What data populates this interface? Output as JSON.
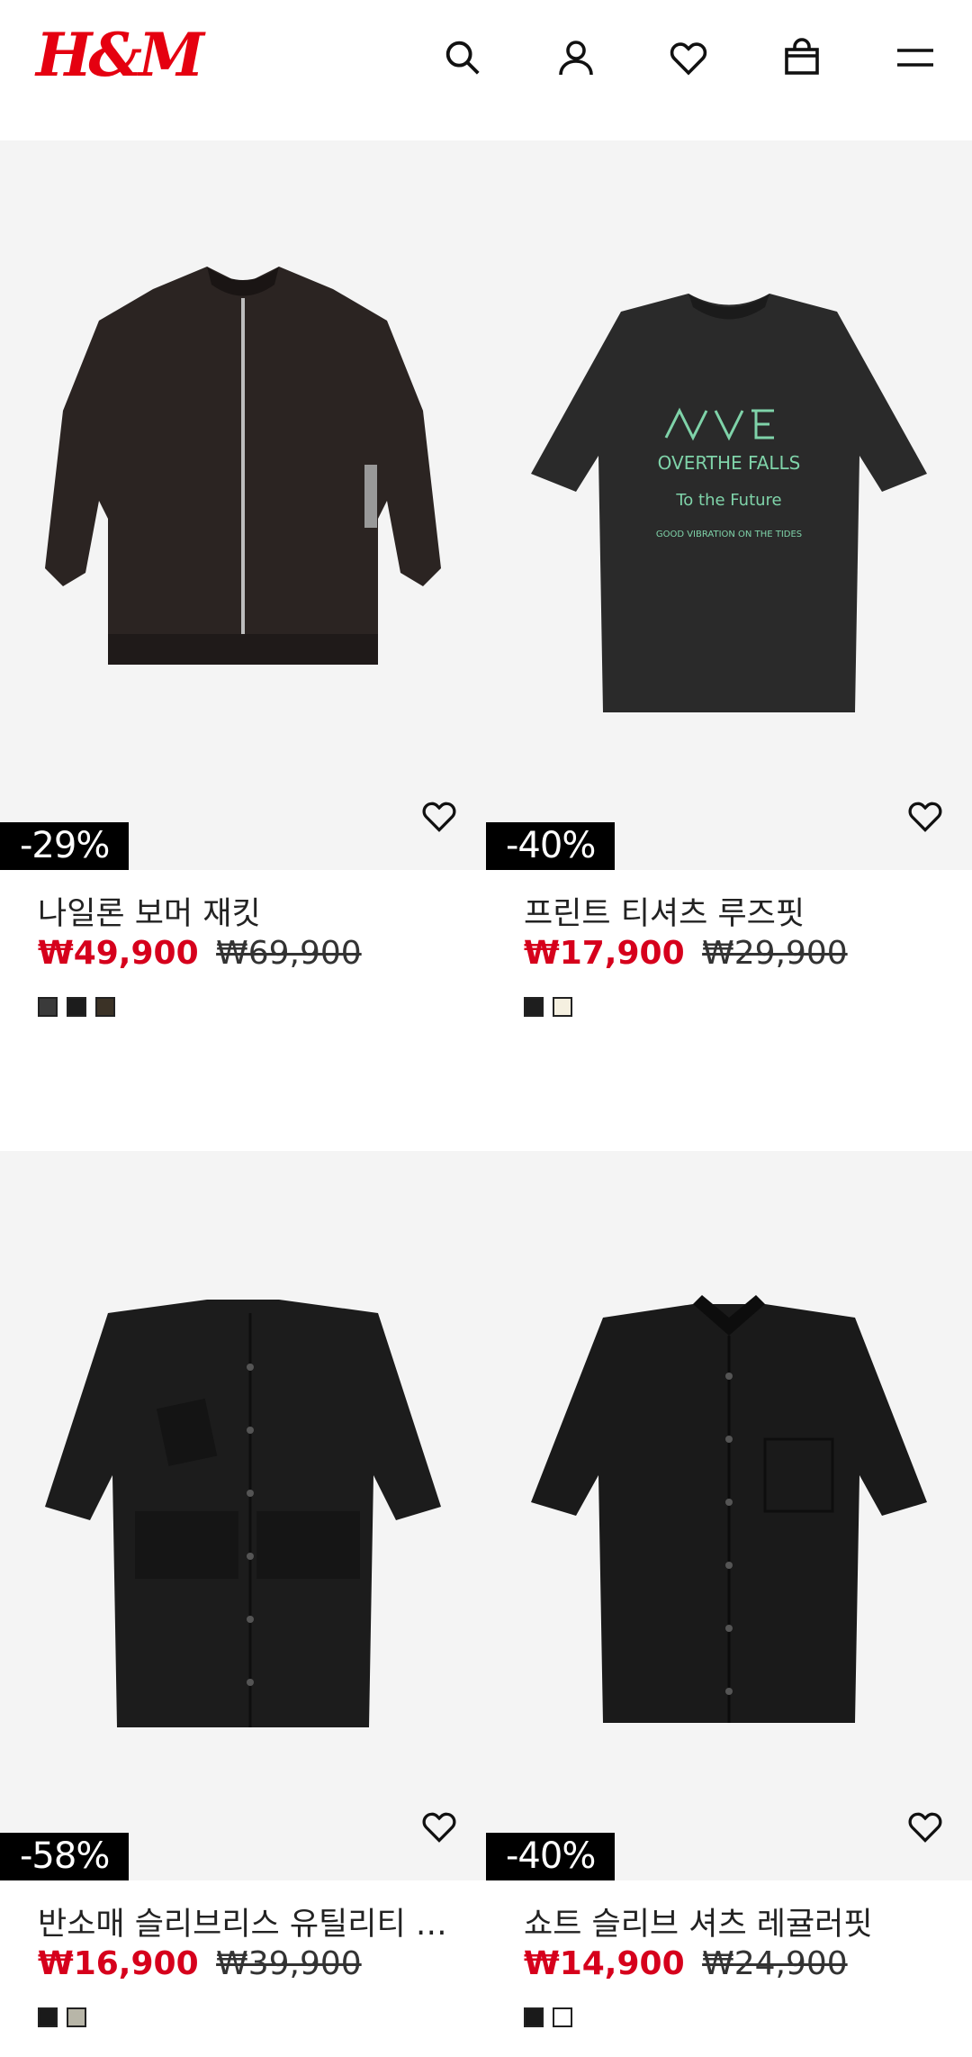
{
  "header": {
    "logo": "H&M",
    "icons": [
      "search-icon",
      "account-icon",
      "wishlist-icon",
      "shopping-bag-icon",
      "menu-icon"
    ]
  },
  "products": [
    {
      "name": "나일론 보머 재킷",
      "discount": "-29%",
      "sale_price": "₩49,900",
      "original_price": "₩69,900",
      "swatches": [
        "#3a3a3a",
        "#1c1c1c",
        "#3b3226"
      ],
      "image": "bomber-jacket"
    },
    {
      "name": "프린트 티셔츠 루즈핏",
      "discount": "-40%",
      "sale_price": "₩17,900",
      "original_price": "₩29,900",
      "swatches": [
        "#1e1e1e",
        "#f5f0e0"
      ],
      "image": "printed-tshirt"
    },
    {
      "name": "반소매 슬리브리스 유틸리티 셔츠",
      "discount": "-58%",
      "sale_price": "₩16,900",
      "original_price": "₩39,900",
      "swatches": [
        "#1a1a1a",
        "#b8b6a8"
      ],
      "image": "utility-shirt"
    },
    {
      "name": "쇼트 슬리브 셔츠 레귤러핏",
      "discount": "-40%",
      "sale_price": "₩14,900",
      "original_price": "₩24,900",
      "swatches": [
        "#1a1a1a",
        "#ffffff"
      ],
      "image": "short-sleeve-shirt"
    }
  ],
  "colors": {
    "brand": "#e50010",
    "sale": "#d6001c",
    "badge_bg": "#000000"
  }
}
